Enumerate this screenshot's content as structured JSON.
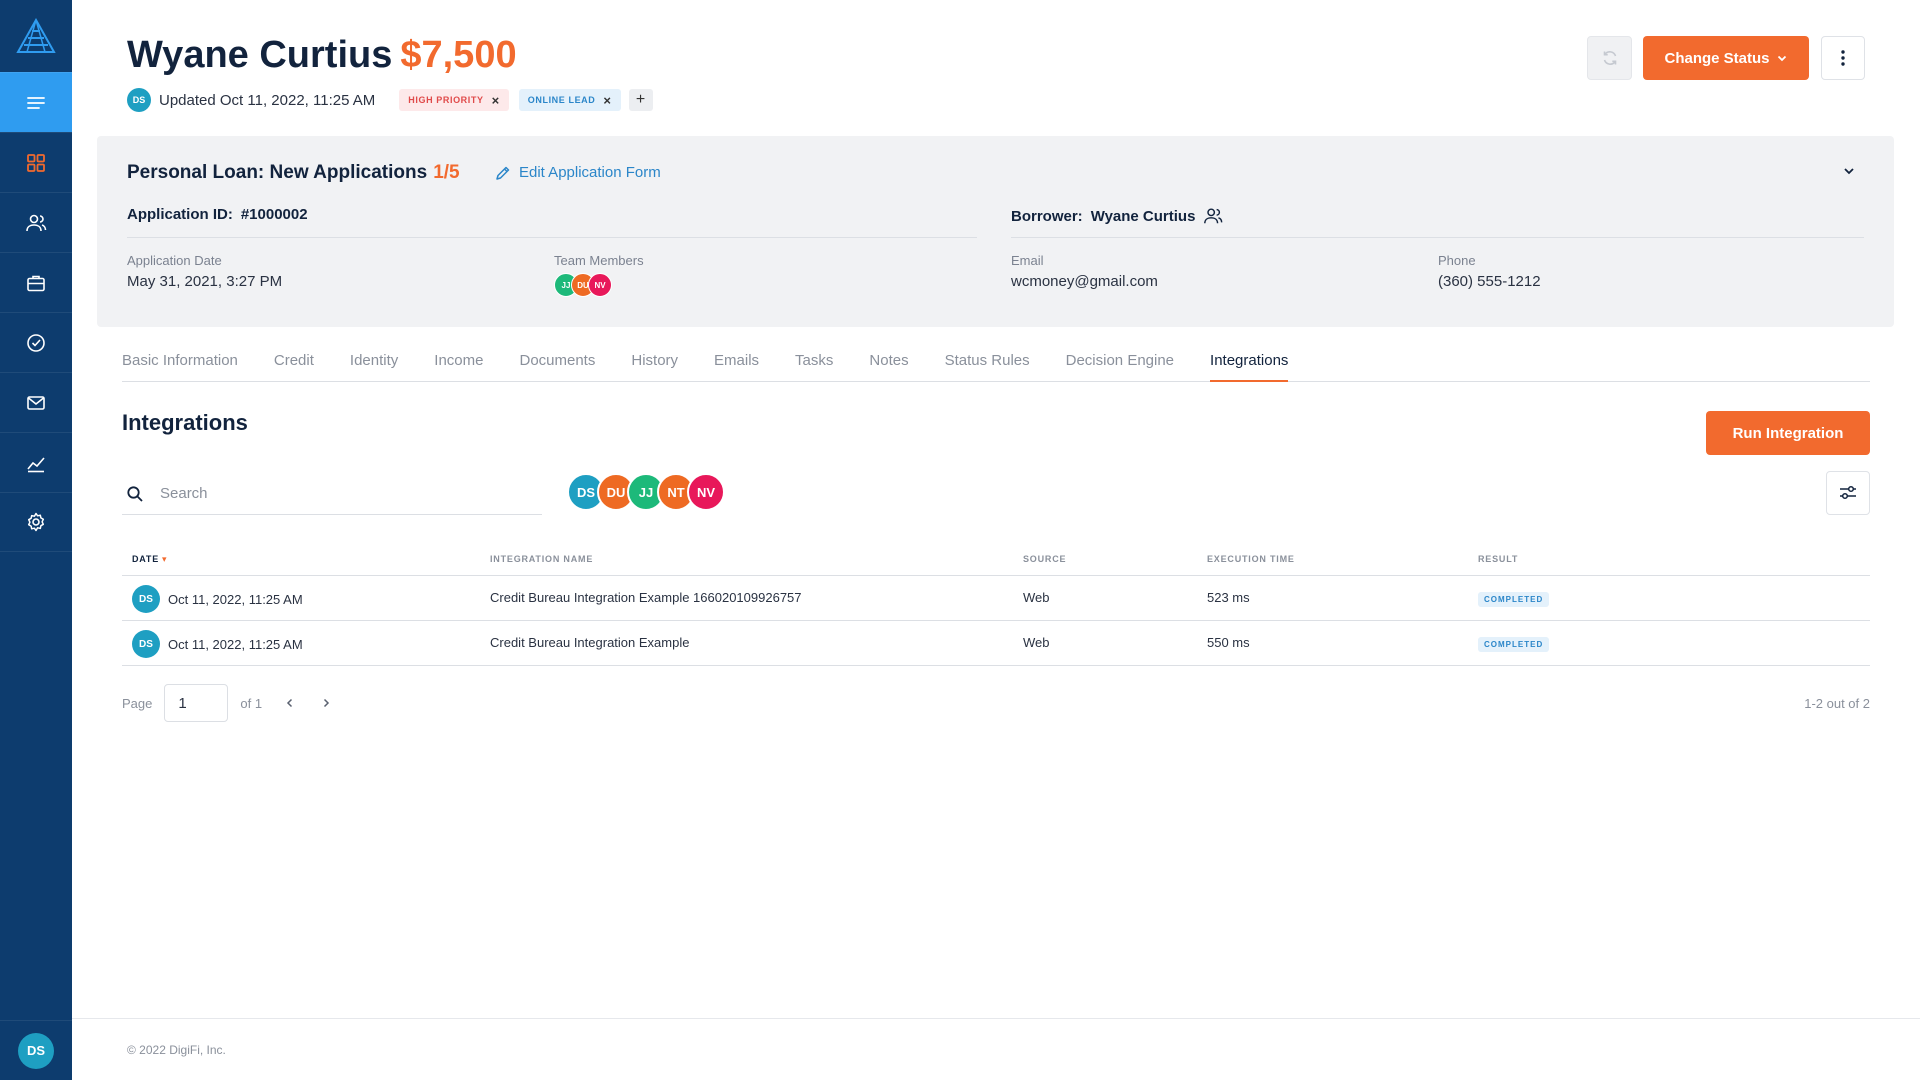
{
  "sidebar": {
    "items": [
      {
        "name": "menu",
        "icon": "menu-icon"
      },
      {
        "name": "dashboard",
        "icon": "grid-icon"
      },
      {
        "name": "contacts",
        "icon": "people-icon"
      },
      {
        "name": "applications",
        "icon": "briefcase-icon"
      },
      {
        "name": "tasks",
        "icon": "check-circle-icon"
      },
      {
        "name": "emails",
        "icon": "mail-icon"
      },
      {
        "name": "reports",
        "icon": "chart-line-icon"
      },
      {
        "name": "settings",
        "icon": "gear-icon"
      }
    ],
    "active_index": 0,
    "user_initials": "DS"
  },
  "header": {
    "name": "Wyane Curtius",
    "amount": "$7,500",
    "updated_initials": "DS",
    "updated_text": "Updated Oct 11, 2022, 11:25 AM",
    "tags": [
      {
        "label": "HIGH PRIORITY",
        "color": "#e04a4a"
      },
      {
        "label": "ONLINE LEAD",
        "color": "#2b86c9"
      }
    ],
    "add_tag": "+",
    "change_status_label": "Change Status"
  },
  "application": {
    "title": "Personal Loan: New Applications",
    "step": "1/5",
    "edit_label": "Edit Application Form",
    "id_label": "Application ID:",
    "id_value": "#1000002",
    "borrower_label": "Borrower:",
    "borrower_value": "Wyane Curtius",
    "date_label": "Application Date",
    "date_value": "May 31, 2021, 3:27 PM",
    "team_label": "Team Members",
    "team": [
      "JJ",
      "DU",
      "NV"
    ],
    "email_label": "Email",
    "email_value": "wcmoney@gmail.com",
    "phone_label": "Phone",
    "phone_value": "(360) 555-1212"
  },
  "tabs": [
    "Basic Information",
    "Credit",
    "Identity",
    "Income",
    "Documents",
    "History",
    "Emails",
    "Tasks",
    "Notes",
    "Status Rules",
    "Decision Engine",
    "Integrations"
  ],
  "active_tab": "Integrations",
  "integrations": {
    "title": "Integrations",
    "run_label": "Run Integration",
    "search_placeholder": "Search",
    "filter_users": [
      "DS",
      "DU",
      "JJ",
      "NT",
      "NV"
    ],
    "columns": {
      "date": "DATE",
      "sort_arrow": "▾",
      "name": "INTEGRATION NAME",
      "source": "SOURCE",
      "time": "EXECUTION TIME",
      "result": "RESULT"
    },
    "rows": [
      {
        "initials": "DS",
        "date": "Oct 11, 2022, 11:25 AM",
        "name": "Credit Bureau Integration Example 166020109926757",
        "source": "Web",
        "time": "523 ms",
        "result": "COMPLETED"
      },
      {
        "initials": "DS",
        "date": "Oct 11, 2022, 11:25 AM",
        "name": "Credit Bureau Integration Example",
        "source": "Web",
        "time": "550 ms",
        "result": "COMPLETED"
      }
    ]
  },
  "pagination": {
    "page_label": "Page",
    "current_page": "1",
    "of_label": "of 1",
    "range": "1-2 out of 2"
  },
  "footer": "© 2022 DigiFi, Inc.",
  "colors": {
    "sidebar": "#0d3c6e",
    "sidebar_active": "#2f9cf0",
    "accent": "#f26a2e",
    "link": "#2b86c9"
  }
}
